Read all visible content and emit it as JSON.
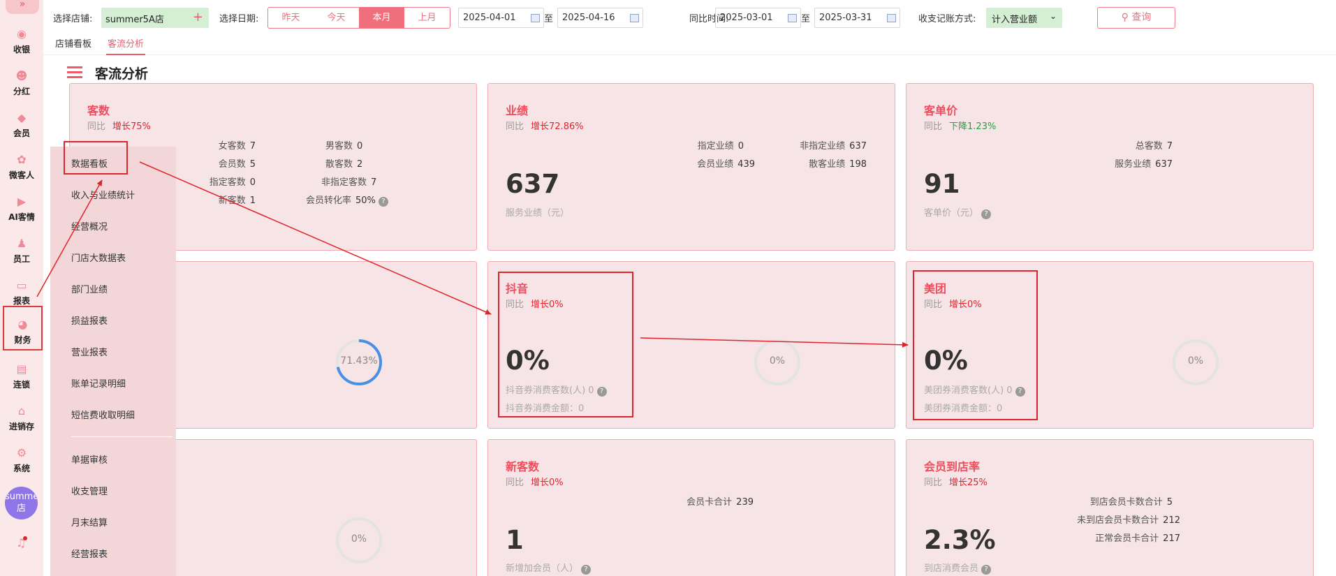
{
  "sidebar": {
    "toggle_label": "»",
    "items": [
      {
        "label": "收银",
        "icon": "cash-register-icon"
      },
      {
        "label": "分红",
        "icon": "dividend-icon"
      },
      {
        "label": "会员",
        "icon": "member-icon"
      },
      {
        "label": "微客人",
        "icon": "micro-guest-icon"
      },
      {
        "label": "AI客情",
        "icon": "ai-customer-icon"
      },
      {
        "label": "员工",
        "icon": "staff-icon"
      },
      {
        "label": "报表",
        "icon": "report-icon"
      },
      {
        "label": "财务",
        "icon": "finance-pie-icon"
      },
      {
        "label": "连锁",
        "icon": "chain-icon"
      },
      {
        "label": "进销存",
        "icon": "inventory-icon"
      },
      {
        "label": "系统",
        "icon": "gear-icon"
      }
    ],
    "avatar_text": "summer5A店",
    "active_item": "财务"
  },
  "filters": {
    "store_label": "选择店铺:",
    "store_value": "summer5A店",
    "date_label": "选择日期:",
    "date_tabs": [
      "昨天",
      "今天",
      "本月",
      "上月"
    ],
    "date_tab_active": "本月",
    "start_date": "2025-04-01",
    "end_date": "2025-04-16",
    "range_sep": "至",
    "compare_label": "同比时间:",
    "compare_start": "2025-03-01",
    "compare_end": "2025-03-31",
    "account_label": "收支记账方式:",
    "account_value": "计入营业额",
    "query_label": "查询"
  },
  "subtabs": [
    "店铺看板",
    "客流分析"
  ],
  "subtab_active": "客流分析",
  "section_title": "客流分析",
  "cards": {
    "traffic": {
      "title": "客数",
      "yoy_label": "同比",
      "yoy_value": "增长75%",
      "stats": [
        {
          "label": "女客数",
          "value": "7"
        },
        {
          "label": "男客数",
          "value": "0"
        },
        {
          "label": "会员数",
          "value": "5"
        },
        {
          "label": "散客数",
          "value": "2"
        },
        {
          "label": "指定客数",
          "value": "0"
        },
        {
          "label": "非指定客数",
          "value": "7"
        },
        {
          "label": "新客数",
          "value": "1"
        },
        {
          "label": "会员转化率",
          "value": "50%"
        }
      ]
    },
    "performance": {
      "title": "业绩",
      "yoy_label": "同比",
      "yoy_value": "增长72.86%",
      "big": "637",
      "sub": "服务业绩（元）",
      "stats": [
        {
          "label": "指定业绩",
          "value": "0"
        },
        {
          "label": "非指定业绩",
          "value": "637"
        },
        {
          "label": "会员业绩",
          "value": "439"
        },
        {
          "label": "散客业绩",
          "value": "198"
        }
      ]
    },
    "avg_price": {
      "title": "客单价",
      "yoy_label": "同比",
      "yoy_value": "下降1.23%",
      "big": "91",
      "sub": "客单价（元）",
      "stats": [
        {
          "label": "总客数",
          "value": "7"
        },
        {
          "label": "服务业绩",
          "value": "637"
        }
      ]
    },
    "ring1": {
      "ring_text": "71.43%",
      "ring_value": 0.7143
    },
    "douyin": {
      "title": "抖音",
      "yoy_label": "同比",
      "yoy_value": "增长0%",
      "big": "0%",
      "line1_label": "抖音券消费客数(人)",
      "line1_value": "0",
      "line2": "抖音券消费金额：0",
      "ring_text": "0%",
      "ring_value": 0
    },
    "meituan": {
      "title": "美团",
      "yoy_label": "同比",
      "yoy_value": "增长0%",
      "big": "0%",
      "line1_label": "美团券消费客数(人)",
      "line1_value": "0",
      "line2": "美团券消费金额：0",
      "ring_text": "0%",
      "ring_value": 0
    },
    "ring3": {
      "ring_text": "0%",
      "ring_value": 0
    },
    "new_customers": {
      "title": "新客数",
      "yoy_label": "同比",
      "yoy_value": "增长0%",
      "big": "1",
      "sub": "新增加会员（人）",
      "stats": [
        {
          "label": "会员卡合计",
          "value": "239"
        }
      ]
    },
    "member_visit": {
      "title": "会员到店率",
      "yoy_label": "同比",
      "yoy_value": "增长25%",
      "big": "2.3%",
      "sub": "到店消费会员",
      "stats": [
        {
          "label": "到店会员卡数合计",
          "value": "5"
        },
        {
          "label": "未到店会员卡数合计",
          "value": "212"
        },
        {
          "label": "正常会员卡合计",
          "value": "217"
        }
      ]
    }
  },
  "dropdown": {
    "items": [
      "数据看板",
      "收入与业绩统计",
      "经营概况",
      "门店大数据表",
      "部门业绩",
      "损益报表",
      "营业报表",
      "账单记录明细",
      "短信费收取明细",
      "单据审核",
      "收支管理",
      "月末结算",
      "经营报表"
    ]
  },
  "colors": {
    "accent": "#ef5b6b",
    "up": "#e0242c",
    "down": "#25a043",
    "ring_blue": "#4a90e2"
  }
}
